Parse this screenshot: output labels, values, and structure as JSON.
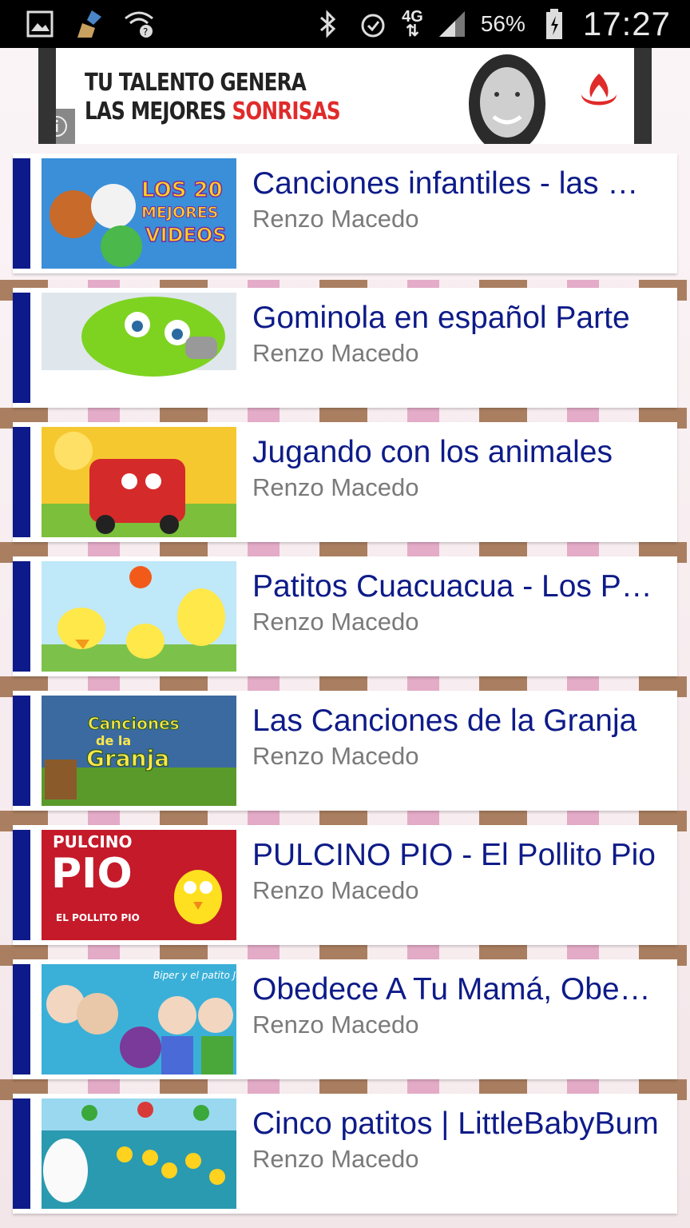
{
  "status_bar": {
    "network": "4G",
    "battery": "56%",
    "time": "17:27",
    "icons": [
      "gallery-icon",
      "cleaner-icon",
      "wifi-unknown-icon",
      "bluetooth-icon",
      "alarm-icon",
      "signal-icon",
      "battery-icon"
    ]
  },
  "ad": {
    "line1": "TU TALENTO GENERA",
    "line2_prefix": "LAS MEJORES ",
    "line2_accent": "SONRISAS",
    "accent_color": "#e02b2b"
  },
  "colors": {
    "accent_bar": "#0d1a8a",
    "title": "#0e1b88",
    "author": "#7a7a7a"
  },
  "videos": [
    {
      "title": "Canciones infantiles - las mejores",
      "author": "Renzo Macedo",
      "thumb_caption": "LOS 20 MEJORES VIDEOS"
    },
    {
      "title": "Gominola  en español  Parte",
      "author": "Renzo Macedo"
    },
    {
      "title": "Jugando con los animales",
      "author": "Renzo Macedo"
    },
    {
      "title": "Patitos Cuacuacua - Los Patitos",
      "author": "Renzo Macedo"
    },
    {
      "title": "Las Canciones de la Granja",
      "author": "Renzo Macedo",
      "thumb_caption": "Canciones de la Granja"
    },
    {
      "title": "PULCINO PIO - El Pollito Pio",
      "author": "Renzo Macedo",
      "thumb_caption": "PULCINO PIO",
      "thumb_subcaption": "EL POLLITO PIO"
    },
    {
      "title": "Obedece A Tu Mamá, Obedece",
      "author": "Renzo Macedo",
      "thumb_caption": "Biper y el patito Juan"
    },
    {
      "title": "Cinco patitos | LittleBabyBum",
      "author": "Renzo Macedo"
    }
  ]
}
